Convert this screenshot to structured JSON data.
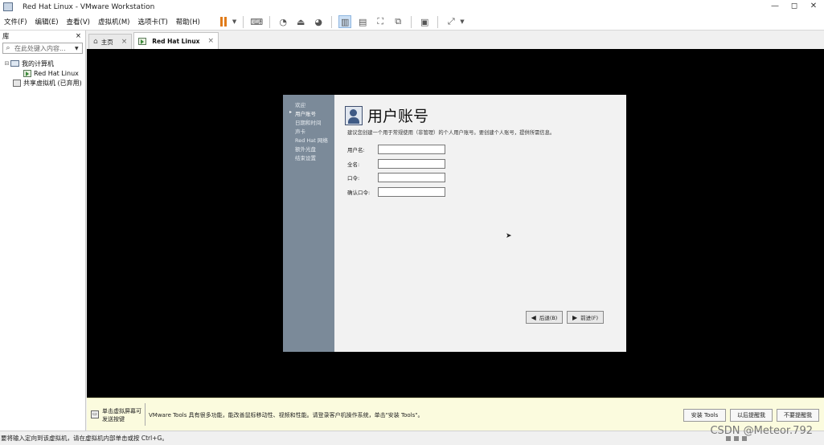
{
  "window": {
    "title": "Red Hat Linux - VMware Workstation",
    "controls": [
      "—",
      "◻",
      "✕"
    ]
  },
  "menu": [
    "文件(F)",
    "编辑(E)",
    "查看(V)",
    "虚拟机(M)",
    "选项卡(T)",
    "帮助(H)"
  ],
  "library": {
    "title": "库",
    "close": "×",
    "search_placeholder": "在此处键入内容...",
    "tree": [
      {
        "label": "我的计算机",
        "level": 0
      },
      {
        "label": "Red Hat Linux",
        "level": 2
      },
      {
        "label": "共享虚拟机 (已弃用)",
        "level": 1
      }
    ]
  },
  "tabs": [
    {
      "label": "主页",
      "icon": "home-icon",
      "active": false
    },
    {
      "label": "Red Hat Linux",
      "icon": "vm-icon",
      "active": true
    }
  ],
  "installer": {
    "steps": [
      "欢迎",
      "用户账号",
      "日期和时间",
      "声卡",
      "Red Hat 网络",
      "额外光盘",
      "结束设置"
    ],
    "current_step": 1,
    "title": "用户账号",
    "description": "建议您创建一个用于常规使用（非管理）的个人用户账号。要创建个人账号，提供所需信息。",
    "fields": [
      {
        "label": "用户名:",
        "value": ""
      },
      {
        "label": "全名:",
        "value": ""
      },
      {
        "label": "口令:",
        "value": ""
      },
      {
        "label": "确认口令:",
        "value": ""
      }
    ],
    "back_label": "后退(B)",
    "forward_label": "前进(F)"
  },
  "infobar": {
    "hint": "单击虚拟屏幕可发送按键",
    "message": "VMware Tools 具有很多功能，能改善鼠标移动性、视频和性能。请登录客户机操作系统，单击\"安装 Tools\"。",
    "buttons": [
      "安装 Tools",
      "以后提醒我",
      "不要提醒我"
    ]
  },
  "statusbar": {
    "text": "要将输入定向到该虚拟机，请在虚拟机内部单击或按 Ctrl+G。",
    "watermark": "CSDN @Meteor.792"
  }
}
